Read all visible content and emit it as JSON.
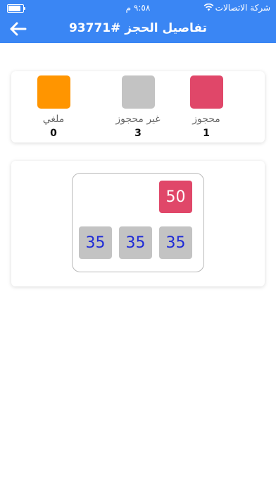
{
  "status_bar": {
    "carrier": "شركة الاتصالات",
    "time": "٩:٥٨ م"
  },
  "header": {
    "title": "تفاصيل الحجز #93771"
  },
  "legend": [
    {
      "label": "محجوز",
      "count": "1",
      "color": "#e04769"
    },
    {
      "label": "غير محجوز",
      "count": "3",
      "color": "#c3c3c3"
    },
    {
      "label": "ملغي",
      "count": "0",
      "color": "#ff9500"
    }
  ],
  "seats": [
    {
      "number": "50",
      "status": "booked"
    },
    {
      "number": "35",
      "status": "free"
    },
    {
      "number": "35",
      "status": "free"
    },
    {
      "number": "35",
      "status": "free"
    }
  ]
}
